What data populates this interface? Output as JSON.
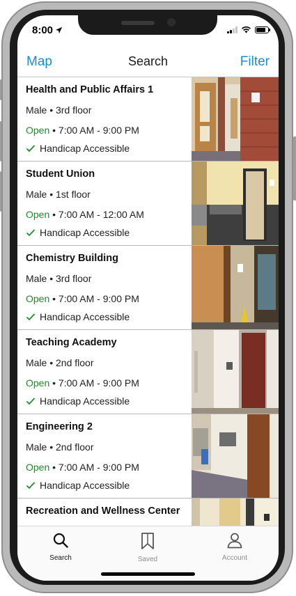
{
  "status": {
    "time": "8:00",
    "location_icon": "location-arrow-icon"
  },
  "nav": {
    "left": "Map",
    "title": "Search",
    "right": "Filter"
  },
  "locations": [
    {
      "name": "Health and Public Affairs 1",
      "floor": "Male • 3rd floor",
      "status": "Open",
      "hours": " • 7:00 AM - 9:00 PM",
      "accessible": "Handicap Accessible"
    },
    {
      "name": "Student Union",
      "floor": "Male • 1st floor",
      "status": "Open",
      "hours": " • 7:00 AM - 12:00 AM",
      "accessible": "Handicap Accessible"
    },
    {
      "name": "Chemistry Building",
      "floor": "Male • 3rd floor",
      "status": "Open",
      "hours": " • 7:00 AM - 9:00 PM",
      "accessible": "Handicap Accessible"
    },
    {
      "name": "Teaching Academy",
      "floor": "Male • 2nd floor",
      "status": "Open",
      "hours": " • 7:00 AM - 9:00 PM",
      "accessible": "Handicap Accessible"
    },
    {
      "name": "Engineering 2",
      "floor": "Male • 2nd floor",
      "status": "Open",
      "hours": " • 7:00 AM - 9:00 PM",
      "accessible": "Handicap Accessible"
    },
    {
      "name": "Recreation and Wellness Center",
      "floor": "",
      "status": "",
      "hours": "",
      "accessible": ""
    }
  ],
  "tabs": [
    {
      "label": "Search",
      "icon": "search-icon",
      "active": true
    },
    {
      "label": "Saved",
      "icon": "bookmark-icon",
      "active": false
    },
    {
      "label": "Account",
      "icon": "person-icon",
      "active": false
    }
  ],
  "colors": {
    "accent": "#1a8cd8",
    "open": "#1f8c2a",
    "inactive": "#8e8e8e"
  }
}
